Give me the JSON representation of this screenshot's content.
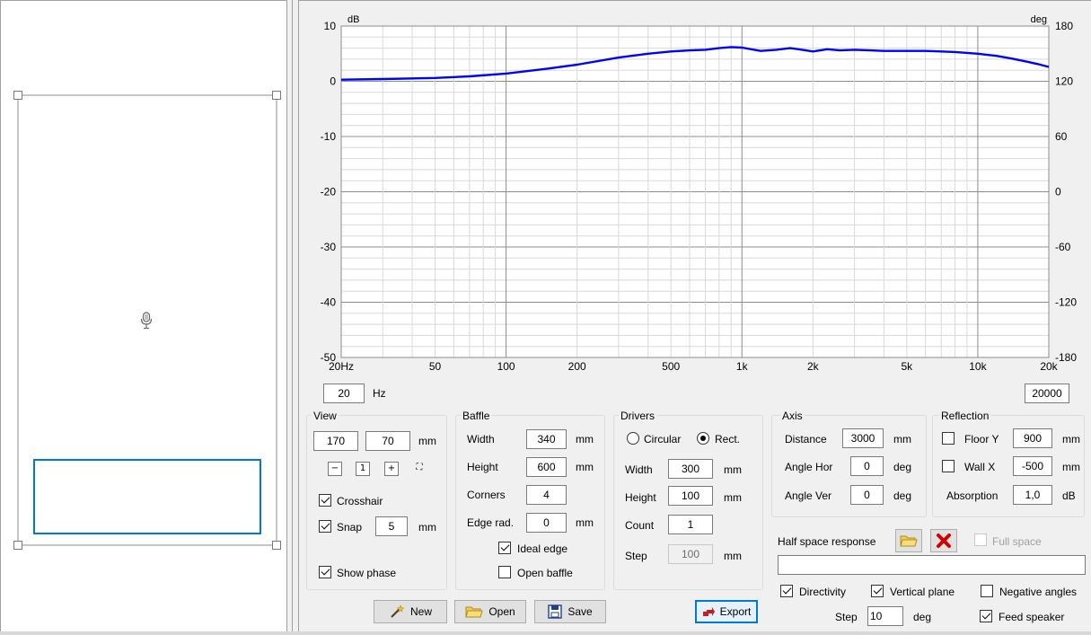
{
  "chart_data": {
    "type": "line",
    "xscale": "log",
    "xlim": [
      20,
      20000
    ],
    "ylim": [
      -50,
      10
    ],
    "y2lim": [
      -180,
      180
    ],
    "y_ticks": [
      "10",
      "0",
      "-10",
      "-20",
      "-30",
      "-40",
      "-50"
    ],
    "y2_ticks": [
      "180",
      "120",
      "60",
      "0",
      "-60",
      "-120",
      "-180"
    ],
    "x_ticks": [
      "20Hz",
      "50",
      "100",
      "200",
      "500",
      "1k",
      "2k",
      "5k",
      "10k",
      "20k"
    ],
    "ylabel": "dB",
    "y2label": "deg",
    "grid": true,
    "series": [
      {
        "color": "#0000ff",
        "x": [
          20,
          30,
          50,
          70,
          100,
          150,
          200,
          300,
          400,
          500,
          600,
          700,
          800,
          900,
          1000,
          1200,
          1400,
          1600,
          1800,
          2000,
          2300,
          2600,
          3000,
          3500,
          4000,
          5000,
          6000,
          7000,
          8000,
          10000,
          12000,
          14000,
          16000,
          18000,
          20000
        ],
        "y": [
          0.3,
          0.4,
          0.6,
          0.9,
          1.4,
          2.3,
          3.0,
          4.3,
          5.0,
          5.4,
          5.6,
          5.7,
          6.0,
          6.2,
          6.1,
          5.5,
          5.7,
          6.0,
          5.7,
          5.4,
          5.8,
          5.6,
          5.7,
          5.6,
          5.5,
          5.5,
          5.5,
          5.4,
          5.3,
          5.0,
          4.6,
          4.1,
          3.6,
          3.1,
          2.6
        ]
      }
    ]
  },
  "freq": {
    "min": "20",
    "max": "20000",
    "unit": "Hz"
  },
  "view": {
    "title": "View",
    "val1": "170",
    "val2": "70",
    "unit": "mm",
    "crosshair_label": "Crosshair",
    "crosshair_checked": true,
    "snap_label": "Snap",
    "snap_value": "5",
    "snap_unit": "mm",
    "snap_checked": true,
    "show_phase_label": "Show phase",
    "show_phase_checked": true
  },
  "baffle": {
    "title": "Baffle",
    "width_label": "Width",
    "width_value": "340",
    "width_unit": "mm",
    "height_label": "Height",
    "height_value": "600",
    "height_unit": "mm",
    "corners_label": "Corners",
    "corners_value": "4",
    "edge_label": "Edge rad.",
    "edge_value": "0",
    "edge_unit": "mm",
    "ideal_edge_label": "Ideal edge",
    "ideal_edge_checked": true,
    "open_baffle_label": "Open baffle",
    "open_baffle_checked": false
  },
  "drivers": {
    "title": "Drivers",
    "circular_label": "Circular",
    "rect_label": "Rect.",
    "selected": "Rect.",
    "width_label": "Width",
    "width_value": "300",
    "width_unit": "mm",
    "height_label": "Height",
    "height_value": "100",
    "height_unit": "mm",
    "count_label": "Count",
    "count_value": "1",
    "step_label": "Step",
    "step_value": "100",
    "step_unit": "mm"
  },
  "axis": {
    "title": "Axis",
    "distance_label": "Distance",
    "distance_value": "3000",
    "distance_unit": "mm",
    "angle_hor_label": "Angle Hor",
    "angle_hor_value": "0",
    "angle_hor_unit": "deg",
    "angle_ver_label": "Angle Ver",
    "angle_ver_value": "0",
    "angle_ver_unit": "deg"
  },
  "reflection": {
    "title": "Reflection",
    "floor_label": "Floor Y",
    "floor_value": "900",
    "floor_unit": "mm",
    "floor_checked": false,
    "wall_label": "Wall  X",
    "wall_value": "-500",
    "wall_unit": "mm",
    "wall_checked": false,
    "absorption_label": "Absorption",
    "absorption_value": "1,0",
    "absorption_unit": "dB"
  },
  "half_space": {
    "label": "Half space response",
    "full_space_label": "Full space",
    "full_space_checked": false,
    "path_value": ""
  },
  "options": {
    "directivity_label": "Directivity",
    "directivity_checked": true,
    "vertical_plane_label": "Vertical plane",
    "vertical_plane_checked": true,
    "negative_angles_label": "Negative angles",
    "negative_angles_checked": false,
    "step_label": "Step",
    "step_value": "10",
    "step_unit": "deg",
    "feed_speaker_label": "Feed speaker",
    "feed_speaker_checked": true
  },
  "buttons": {
    "new": "New",
    "open": "Open",
    "save": "Save",
    "export": "Export"
  },
  "colors": {
    "curve": "#0000ff",
    "driver_rect": "#0078d7",
    "delete": "#d00000",
    "folder": "#e8b93a"
  }
}
